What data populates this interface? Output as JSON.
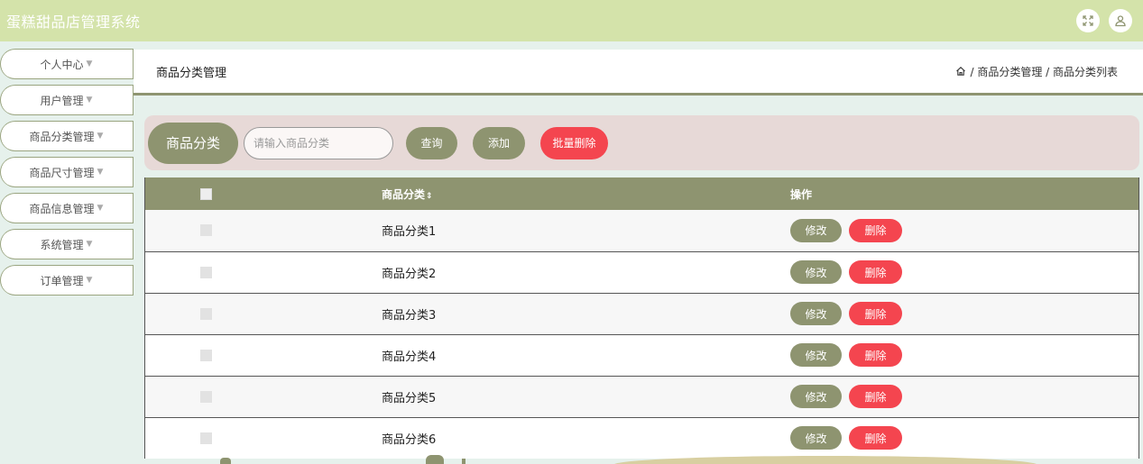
{
  "app": {
    "title": "蛋糕甜品店管理系统"
  },
  "topbar": {
    "icons": [
      "fullscreen-icon",
      "user-icon"
    ]
  },
  "sidebar": {
    "items": [
      {
        "label": "个人中心"
      },
      {
        "label": "用户管理"
      },
      {
        "label": "商品分类管理"
      },
      {
        "label": "商品尺寸管理"
      },
      {
        "label": "商品信息管理"
      },
      {
        "label": "系统管理"
      },
      {
        "label": "订单管理"
      }
    ]
  },
  "header": {
    "title": "商品分类管理",
    "breadcrumb": " / 商品分类管理 / 商品分类列表"
  },
  "search": {
    "label": "商品分类",
    "placeholder": "请输入商品分类",
    "query_label": "查询",
    "add_label": "添加",
    "batch_delete_label": "批量删除"
  },
  "table": {
    "columns": {
      "name": "商品分类",
      "sort_glyph": "⇕",
      "ops": "操作"
    },
    "rows": [
      {
        "name": "商品分类1"
      },
      {
        "name": "商品分类2"
      },
      {
        "name": "商品分类3"
      },
      {
        "name": "商品分类4"
      },
      {
        "name": "商品分类5"
      },
      {
        "name": "商品分类6"
      }
    ],
    "edit_label": "修改",
    "delete_label": "删除"
  },
  "colors": {
    "accent": "#8e9470",
    "danger": "#f4454f",
    "topbar": "#d4e3aa",
    "search_bg": "#e7d9d7"
  }
}
